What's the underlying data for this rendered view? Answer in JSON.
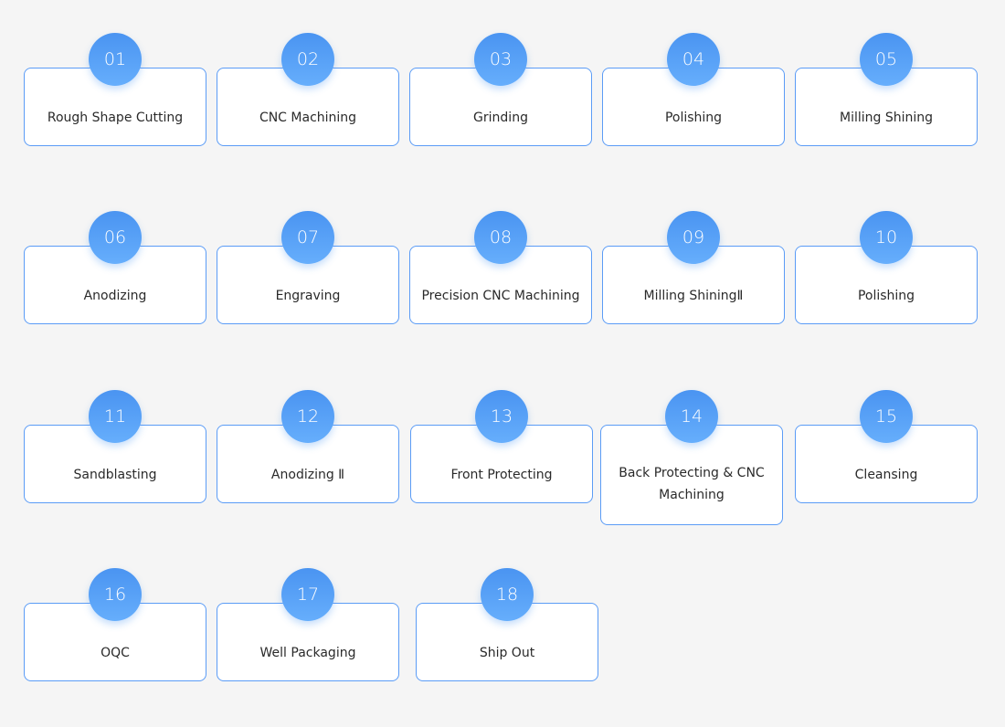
{
  "steps": [
    {
      "number": "01",
      "label": "Rough Shape Cutting"
    },
    {
      "number": "02",
      "label": "CNC Machining"
    },
    {
      "number": "03",
      "label": "Grinding"
    },
    {
      "number": "04",
      "label": "Polishing"
    },
    {
      "number": "05",
      "label": "Milling Shining"
    },
    {
      "number": "06",
      "label": "Anodizing"
    },
    {
      "number": "07",
      "label": "Engraving"
    },
    {
      "number": "08",
      "label": "Precision CNC Machining"
    },
    {
      "number": "09",
      "label": "Milling ShiningⅡ"
    },
    {
      "number": "10",
      "label": "Polishing"
    },
    {
      "number": "11",
      "label": "Sandblasting"
    },
    {
      "number": "12",
      "label": "Anodizing Ⅱ"
    },
    {
      "number": "13",
      "label": "Front Protecting"
    },
    {
      "number": "14",
      "label": "Back Protecting & CNC Machining"
    },
    {
      "number": "15",
      "label": "Cleansing"
    },
    {
      "number": "16",
      "label": "OQC"
    },
    {
      "number": "17",
      "label": "Well Packaging"
    },
    {
      "number": "18",
      "label": "Ship Out"
    }
  ],
  "colors": {
    "accent": "#4a94f1",
    "border": "#5b9cf6",
    "background": "#f5f5f5"
  }
}
